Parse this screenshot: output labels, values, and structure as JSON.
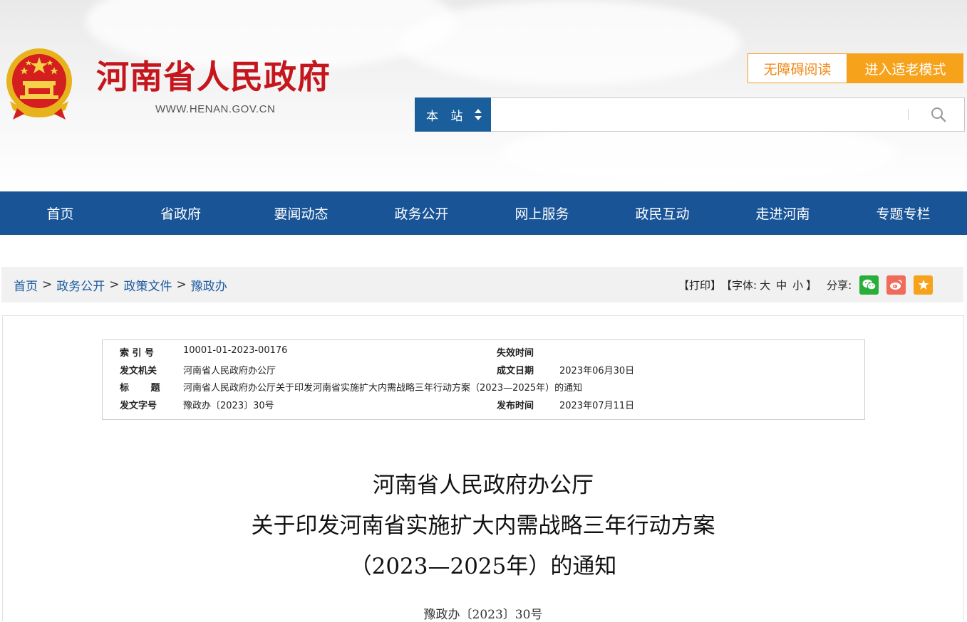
{
  "header": {
    "site_title": "河南省人民政府",
    "site_url": "WWW.HENAN.GOV.CN",
    "accessibility_label": "无障碍阅读",
    "elder_mode_label": "进入适老模式",
    "search": {
      "scope_label": "本 站",
      "placeholder": ""
    }
  },
  "nav": {
    "items": [
      "首页",
      "省政府",
      "要闻动态",
      "政务公开",
      "网上服务",
      "政民互动",
      "走进河南",
      "专题专栏"
    ]
  },
  "breadcrumb": {
    "items": [
      "首页",
      "政务公开",
      "政策文件",
      "豫政办"
    ],
    "separator": ">"
  },
  "tools": {
    "print_label": "【打印】",
    "font_label": "【字体:",
    "font_large": "大",
    "font_medium": "中",
    "font_small": "小",
    "font_close": "】",
    "share_label": "分享:",
    "share_icons": [
      "wechat-icon",
      "weibo-icon",
      "favorite-icon"
    ]
  },
  "meta": {
    "index_no_label": "索 引 号",
    "index_no": "10001-01-2023-00176",
    "expiry_label": "失效时间",
    "expiry": "",
    "issuer_label": "发文机关",
    "issuer": "河南省人民政府办公厅",
    "created_label": "成文日期",
    "created": "2023年06月30日",
    "title_label": "标 题",
    "title": "河南省人民政府办公厅关于印发河南省实施扩大内需战略三年行动方案（2023—2025年）的通知",
    "doc_no_label": "发文字号",
    "doc_no": "豫政办〔2023〕30号",
    "published_label": "发布时间",
    "published": "2023年07月11日"
  },
  "document": {
    "title_line1": "河南省人民政府办公厅",
    "title_line2": "关于印发河南省实施扩大内需战略三年行动方案",
    "title_line3": "（2023—2025年）的通知",
    "doc_number": "豫政办〔2023〕30号"
  },
  "colors": {
    "brand_red": "#c4161c",
    "nav_blue": "#195497",
    "accent_orange": "#f7a21b",
    "link_blue": "#1a5aa0"
  }
}
